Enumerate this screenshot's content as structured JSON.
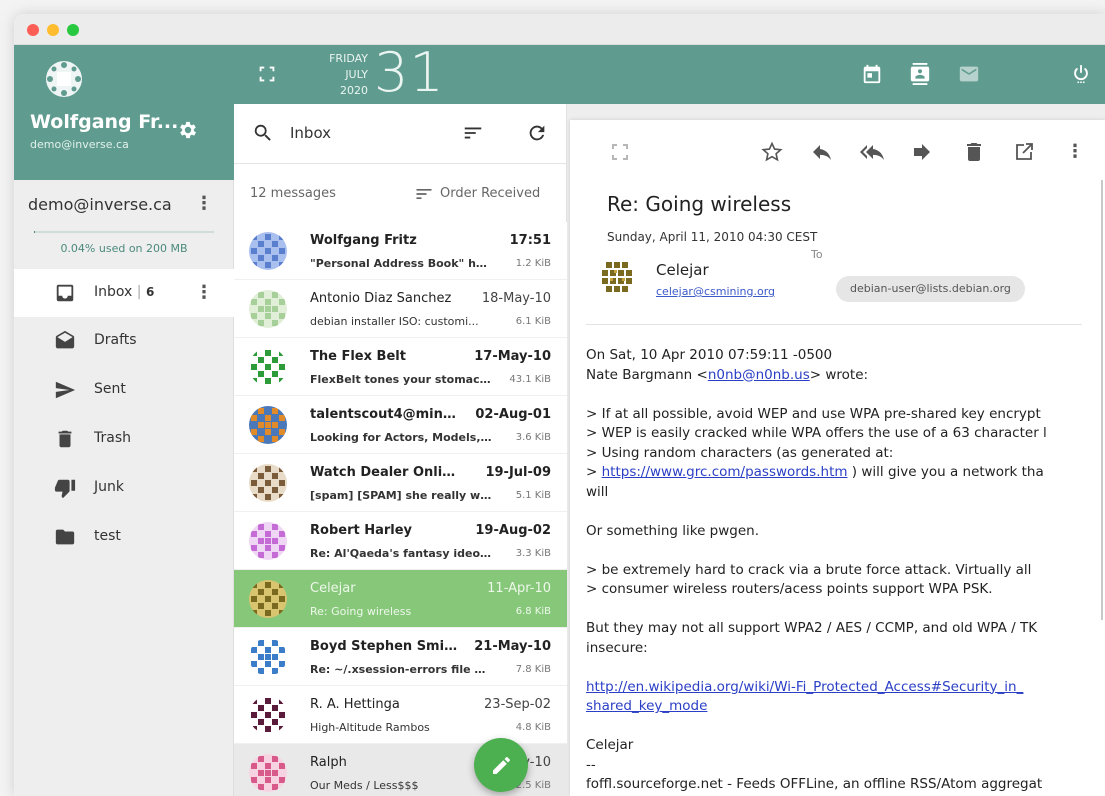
{
  "colors": {
    "accent": "#5f9c8f",
    "selected_row": "#86c77a",
    "fab": "#4caf50",
    "link": "#2a3fc5"
  },
  "window_controls": [
    "close-dot",
    "minimize-dot",
    "zoom-dot"
  ],
  "sidebar": {
    "user_name": "Wolfgang Fr...",
    "user_email": "demo@inverse.ca",
    "account": "demo@inverse.ca",
    "quota": "0.04% used on 200 MB",
    "quota_fraction": 0.0004,
    "folders": [
      {
        "label": "Inbox",
        "count": "6",
        "icon": "inbox-icon",
        "active": true
      },
      {
        "label": "Drafts",
        "icon": "drafts-icon"
      },
      {
        "label": "Sent",
        "icon": "sent-icon"
      },
      {
        "label": "Trash",
        "icon": "trash-icon"
      },
      {
        "label": "Junk",
        "icon": "junk-icon"
      },
      {
        "label": "test",
        "icon": "folder-icon"
      }
    ]
  },
  "topbar": {
    "weekday": "FRIDAY",
    "month": "JULY",
    "year": "2020",
    "day": "31",
    "icons": [
      "fullscreen-icon",
      "calendar-icon",
      "contacts-icon",
      "mail-icon",
      "power-icon"
    ]
  },
  "list": {
    "search_label": "Inbox",
    "count": "12 messages",
    "sort": "Order Received",
    "messages": [
      {
        "from": "Wolfgang Fritz",
        "date": "17:51",
        "subject": "\"Personal Address Book\" has...",
        "size": "1.2 KiB",
        "unread": true,
        "avatar": "blue-pattern"
      },
      {
        "from": "Antonio Diaz Sanchez",
        "date": "18-May-10",
        "subject": "debian installer ISO: customi...",
        "size": "6.1 KiB",
        "unread": false,
        "avatar": "green-pattern"
      },
      {
        "from": "The Flex Belt",
        "date": "17-May-10",
        "subject": "FlexBelt tones your stomach...",
        "size": "43.1 KiB",
        "unread": true,
        "avatar": "green-dots"
      },
      {
        "from": "talentscout4@mind...",
        "date": "02-Aug-01",
        "subject": "Looking for Actors, Models, S...",
        "size": "3.6 KiB",
        "unread": true,
        "avatar": "orange-pattern"
      },
      {
        "from": "Watch Dealer Online",
        "date": "19-Jul-09",
        "subject": "[spam] [SPAM] she really wan...",
        "size": "5.1 KiB",
        "unread": true,
        "avatar": "brown-pattern"
      },
      {
        "from": "Robert Harley",
        "date": "19-Aug-02",
        "subject": "Re: Al'Qaeda's fantasy ideolo...",
        "size": "3.3 KiB",
        "unread": true,
        "avatar": "purple-pattern"
      },
      {
        "from": "Celejar",
        "date": "11-Apr-10",
        "subject": "Re: Going wireless",
        "size": "6.8 KiB",
        "unread": false,
        "selected": true,
        "avatar": "olive-pattern"
      },
      {
        "from": "Boyd Stephen Smith...",
        "date": "21-May-10",
        "subject": "Re: ~/.xsession-errors file gr...",
        "size": "7.8 KiB",
        "unread": true,
        "avatar": "kde-pattern"
      },
      {
        "from": "R. A. Hettinga",
        "date": "23-Sep-02",
        "subject": "High-Altitude Rambos",
        "size": "4.8 KiB",
        "unread": false,
        "avatar": "maroon-pattern"
      },
      {
        "from": "Ralph",
        "date": "06-May-10",
        "subject": "Our Meds / Less$$$",
        "size": "2.5 KiB",
        "unread": false,
        "grey": true,
        "avatar": "pink-pattern"
      }
    ]
  },
  "reader": {
    "subject": "Re: Going wireless",
    "date": "Sunday, April 11, 2010 04:30 CEST",
    "sender_name": "Celejar",
    "sender_email": "celejar@csmining.org",
    "to_label": "To",
    "to": "debian-user@lists.debian.org",
    "actions": [
      "expand-icon",
      "star-icon",
      "reply-icon",
      "reply-all-icon",
      "forward-icon",
      "delete-icon",
      "open-in-window-icon",
      "more-icon"
    ],
    "body": {
      "l1": "On Sat, 10 Apr 2010 07:59:11 -0500",
      "l2a": "Nate Bargmann <",
      "l2link": "n0nb@n0nb.us",
      "l2b": "> wrote:",
      "q1": "> If at all possible, avoid WEP and use WPA pre-shared key encrypt",
      "q2": "> WEP is easily cracked while WPA offers the use of a 63 character l",
      "q3": "> Using random characters (as generated at:",
      "q4a": "> ",
      "q4link": "https://www.grc.com/passwords.htm",
      "q4b": " ) will give you a network tha",
      "q5": "will",
      "p2": "Or something like pwgen.",
      "q6": "> be extremely hard to crack via a brute force attack.  Virtually all",
      "q7": "> consumer wireless routers/acess points support WPA PSK.",
      "p3a": "But they may not all support WPA2 / AES / CCMP, and old WPA / TK",
      "p3b": "insecure:",
      "link1": "http://en.wikipedia.org/wiki/Wi-Fi_Protected_Access#Security_in_",
      "link2": "shared_key_mode",
      "sig": "Celejar",
      "sigsep": "--",
      "footer": "foffl.sourceforge.net - Feeds OFFLine, an offline RSS/Atom aggregat"
    }
  }
}
